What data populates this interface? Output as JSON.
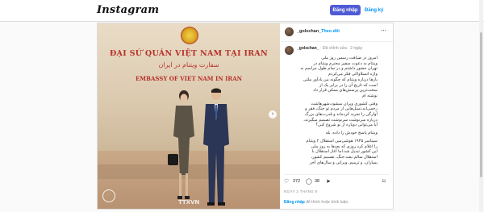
{
  "header": {
    "logo": "Instagram",
    "login_label": "Đăng nhập",
    "signup_label": "Đăng ký"
  },
  "post": {
    "username": "_golschan_",
    "verified_text": "Đã chỉnh sửa",
    "time": "2 ngày",
    "follow_label": "Theo dõi",
    "image_text": {
      "sign_line1": "ĐẠI SỨ QUÁN VIỆT NAM TẠI IRAN",
      "sign_line2": "سفارت ویتنام در ایران",
      "sign_line3": "EMBASSY OF VIET NAM IN IRAN"
    },
    "caption_lines": [
      "امروز در ضیافت رسمی روز ملی",
      "ویتنام به دعوت سفیر محترم ویتنام در",
      "تهران حضور داشتم و در تمام طول مراسم به",
      "واژه اتسلاواکی فکر می‌کردم",
      "بارها درباره ویتنام که چگونه من یادآور ملتی",
      "است که تاریخ آن را در برابر یک از",
      "سخت‌ترین پرسش‌های ممکن قرار داد",
      "نوشته ام",
      "وقتی کشوری ویران میشود،شهرهاشت",
      "زخمی‌اند،نسل‌هایی از مردم تو جنگ، فقر و",
      "آوارگی را تجربه کرده‌اند و قدرت‌های بزرگ",
      "درباره سرنوشت سرنوشت تصمیم میگیرند،",
      "آیا می‌توانی دوباره از نو شروع کنی؟",
      "ویتنام پاسخ خودش را داده. بله",
      "سپتامبر ۱۹۴۵ هوشی‌مین استقلال ۲ ویتنام",
      "را اعلام کرد.روزی که بعدها به روز ملی",
      "این کشور تبدیل شد.اما آغاز استقلال با",
      "استقلال سالم نشد.جنگ، تقسیم کشور،",
      "بمباران، و ترمیم، ویرانی و سال‌های آخر"
    ],
    "likes": "372",
    "comments": "38",
    "date": "NGÀY 2 THÁNG 9",
    "login_prompt_link": "Đăng nhập",
    "login_prompt_text": "để thích hoặc bình luận."
  },
  "watermark": "TTXVN"
}
